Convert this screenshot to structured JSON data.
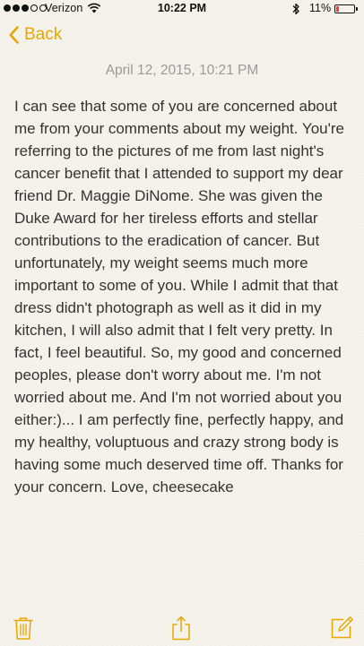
{
  "status_bar": {
    "carrier": "Verizon",
    "time": "10:22 PM",
    "battery": "11%",
    "signal_bars_filled": 3,
    "signal_bars_total": 5
  },
  "nav": {
    "back_label": "Back",
    "accent_color": "#e8a700"
  },
  "note": {
    "date": "April 12, 2015, 10:21 PM",
    "body": "I can see that some of you are concerned about me from your comments about my weight. You're referring to the pictures of me from last night's cancer benefit that I attended to support my dear friend Dr. Maggie DiNome. She was given the Duke Award for her tireless efforts and stellar contributions to the eradication of cancer. But unfortunately, my weight seems much more important to some of you. While I admit that that dress didn't photograph as well as it did in my kitchen, I will also admit that I felt very pretty. In fact, I feel beautiful. So, my good and concerned peoples, please don't worry about me. I'm not worried about me. And I'm not worried about you either:)... I am perfectly fine, perfectly happy, and my healthy, voluptuous and crazy strong body is having some much deserved time off. Thanks for your concern. Love, cheesecake"
  },
  "toolbar": {
    "icons": [
      "trash-icon",
      "share-icon",
      "compose-icon"
    ]
  }
}
